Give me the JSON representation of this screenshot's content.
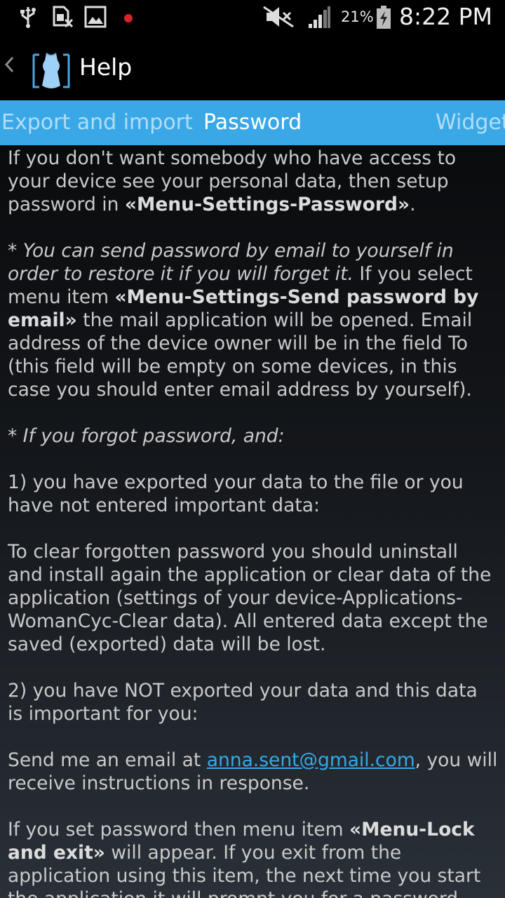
{
  "status_bar": {
    "icons": [
      "usb-icon",
      "no-sim-icon",
      "gallery-icon",
      "record-dot-icon",
      "mute-icon",
      "signal-icon",
      "battery-charging-icon"
    ],
    "battery_percent": "21%",
    "time": "8:22 PM"
  },
  "action_bar": {
    "title": "Help",
    "back_icon": "chevron-left-icon",
    "app_icon": "app-logo-icon"
  },
  "tabs": [
    {
      "label": "Export and import",
      "active": false
    },
    {
      "label": "Password",
      "active": true
    },
    {
      "label": "Widget",
      "active": false
    }
  ],
  "content": {
    "p1_a": "If you don't want somebody who have access to your device see your personal data, then setup password in ",
    "p1_b": "«Menu-Settings-Password»",
    "p1_c": ".",
    "p2_italic": "* You can send password by email to yourself in order to restore it if you will forget it.",
    "p2_a": " If you select menu item ",
    "p2_b": "«Menu-Settings-Send password by email»",
    "p2_c": " the mail application will be opened. Email address of the device owner will be in the field To (this field will be empty on some devices, in this case you should enter email address by yourself).",
    "p3_italic": "* If you forgot password, and:",
    "p4": "1) you have exported your data to the file or you have not entered important data:",
    "p5": "To clear forgotten password you should uninstall and install again the application or clear data of the application (settings of your device-Applications-WomanCyc-Clear data). All entered data except the saved (exported) data will be lost.",
    "p6": "2) you have NOT exported your data and this data is important for you:",
    "p7_a": "Send me an email at ",
    "p7_link": "anna.sent@gmail.com",
    "p7_c": ", you will receive instructions in response.",
    "p8_a": "If you set password then menu item ",
    "p8_b": "«Menu-Lock and exit»",
    "p8_c": " will appear. If you exit from the application using this item, the next time you start the application it will prompt you for a password."
  },
  "colors": {
    "tab_bar": "#3aa8e6",
    "link": "#35a9e6",
    "body_text": "#c9c9c9"
  }
}
